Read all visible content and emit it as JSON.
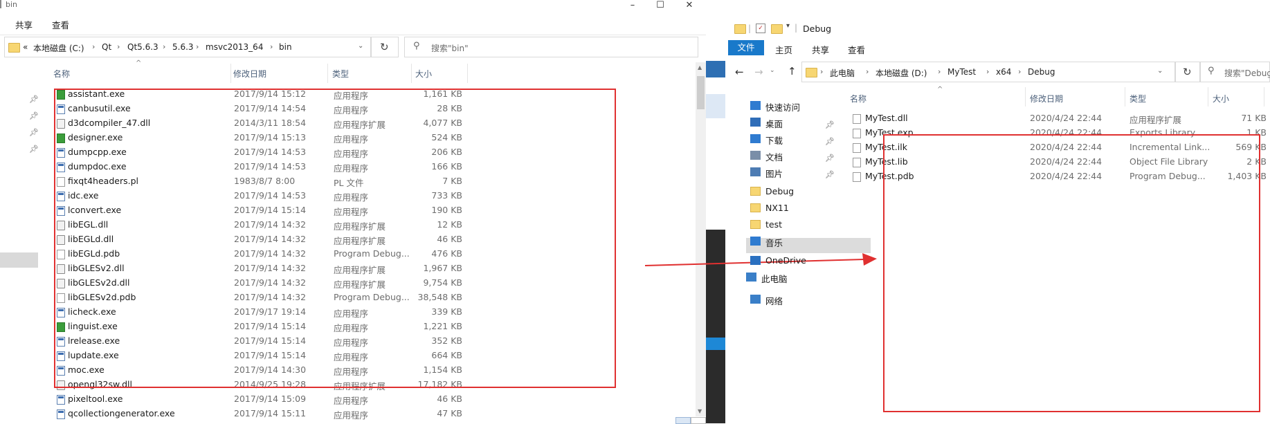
{
  "left_window": {
    "title": "bin",
    "ribbon_tabs": [
      "共享",
      "查看"
    ],
    "address": {
      "prefix": "«",
      "crumbs": [
        "本地磁盘 (C:)",
        "Qt",
        "Qt5.6.3",
        "5.6.3",
        "msvc2013_64",
        "bin"
      ]
    },
    "search_placeholder": "搜索\"bin\"",
    "columns": {
      "name": "名称",
      "date": "修改日期",
      "type": "类型",
      "size": "大小"
    },
    "files": [
      {
        "name": "assistant.exe",
        "date": "2017/9/14 15:12",
        "type": "应用程序",
        "size": "1,161 KB",
        "icon": "qt-icon"
      },
      {
        "name": "canbusutil.exe",
        "date": "2017/9/14 14:54",
        "type": "应用程序",
        "size": "28 KB",
        "icon": "exe-icon"
      },
      {
        "name": "d3dcompiler_47.dll",
        "date": "2014/3/11 18:54",
        "type": "应用程序扩展",
        "size": "4,077 KB",
        "icon": "dll-icon"
      },
      {
        "name": "designer.exe",
        "date": "2017/9/14 15:13",
        "type": "应用程序",
        "size": "524 KB",
        "icon": "qt-icon"
      },
      {
        "name": "dumpcpp.exe",
        "date": "2017/9/14 14:53",
        "type": "应用程序",
        "size": "206 KB",
        "icon": "exe-icon"
      },
      {
        "name": "dumpdoc.exe",
        "date": "2017/9/14 14:53",
        "type": "应用程序",
        "size": "166 KB",
        "icon": "exe-icon"
      },
      {
        "name": "fixqt4headers.pl",
        "date": "1983/8/7 8:00",
        "type": "PL 文件",
        "size": "7 KB",
        "icon": "doc-icon"
      },
      {
        "name": "idc.exe",
        "date": "2017/9/14 14:53",
        "type": "应用程序",
        "size": "733 KB",
        "icon": "exe-icon"
      },
      {
        "name": "lconvert.exe",
        "date": "2017/9/14 15:14",
        "type": "应用程序",
        "size": "190 KB",
        "icon": "exe-icon"
      },
      {
        "name": "libEGL.dll",
        "date": "2017/9/14 14:32",
        "type": "应用程序扩展",
        "size": "12 KB",
        "icon": "dll-icon"
      },
      {
        "name": "libEGLd.dll",
        "date": "2017/9/14 14:32",
        "type": "应用程序扩展",
        "size": "46 KB",
        "icon": "dll-icon"
      },
      {
        "name": "libEGLd.pdb",
        "date": "2017/9/14 14:32",
        "type": "Program Debug...",
        "size": "476 KB",
        "icon": "doc-icon"
      },
      {
        "name": "libGLESv2.dll",
        "date": "2017/9/14 14:32",
        "type": "应用程序扩展",
        "size": "1,967 KB",
        "icon": "dll-icon"
      },
      {
        "name": "libGLESv2d.dll",
        "date": "2017/9/14 14:32",
        "type": "应用程序扩展",
        "size": "9,754 KB",
        "icon": "dll-icon"
      },
      {
        "name": "libGLESv2d.pdb",
        "date": "2017/9/14 14:32",
        "type": "Program Debug...",
        "size": "38,548 KB",
        "icon": "doc-icon"
      },
      {
        "name": "licheck.exe",
        "date": "2017/9/17 19:14",
        "type": "应用程序",
        "size": "339 KB",
        "icon": "exe-icon"
      },
      {
        "name": "linguist.exe",
        "date": "2017/9/14 15:14",
        "type": "应用程序",
        "size": "1,221 KB",
        "icon": "qt-icon"
      },
      {
        "name": "lrelease.exe",
        "date": "2017/9/14 15:14",
        "type": "应用程序",
        "size": "352 KB",
        "icon": "exe-icon"
      },
      {
        "name": "lupdate.exe",
        "date": "2017/9/14 15:14",
        "type": "应用程序",
        "size": "664 KB",
        "icon": "exe-icon"
      },
      {
        "name": "moc.exe",
        "date": "2017/9/14 14:30",
        "type": "应用程序",
        "size": "1,154 KB",
        "icon": "exe-icon"
      },
      {
        "name": "opengl32sw.dll",
        "date": "2014/9/25 19:28",
        "type": "应用程序扩展",
        "size": "17,182 KB",
        "icon": "dll-icon"
      },
      {
        "name": "pixeltool.exe",
        "date": "2017/9/14 15:09",
        "type": "应用程序",
        "size": "46 KB",
        "icon": "exe-icon"
      },
      {
        "name": "qcollectiongenerator.exe",
        "date": "2017/9/14 15:11",
        "type": "应用程序",
        "size": "47 KB",
        "icon": "exe-icon"
      }
    ]
  },
  "right_window": {
    "title": "Debug",
    "ribbon_tabs": [
      "文件",
      "主页",
      "共享",
      "查看"
    ],
    "address": {
      "crumbs": [
        "此电脑",
        "本地磁盘 (D:)",
        "MyTest",
        "x64",
        "Debug"
      ]
    },
    "search_placeholder": "搜索\"Debug\"",
    "columns": {
      "name": "名称",
      "date": "修改日期",
      "type": "类型",
      "size": "大小"
    },
    "nav": [
      {
        "label": "快速访问",
        "icon": "star-icon"
      },
      {
        "label": "桌面",
        "icon": "desktop-icon"
      },
      {
        "label": "下载",
        "icon": "download-icon"
      },
      {
        "label": "文档",
        "icon": "documents-icon"
      },
      {
        "label": "图片",
        "icon": "pictures-icon"
      },
      {
        "label": "Debug",
        "icon": "folder-icon"
      },
      {
        "label": "NX11",
        "icon": "folder-icon"
      },
      {
        "label": "test",
        "icon": "folder-icon"
      },
      {
        "label": "音乐",
        "icon": "music-icon"
      },
      {
        "label": "OneDrive",
        "icon": "onedrive-icon"
      },
      {
        "label": "此电脑",
        "icon": "pc-icon"
      },
      {
        "label": "网络",
        "icon": "network-icon"
      }
    ],
    "files": [
      {
        "name": "MyTest.dll",
        "date": "2020/4/24 22:44",
        "type": "应用程序扩展",
        "size": "71 KB"
      },
      {
        "name": "MyTest.exp",
        "date": "2020/4/24 22:44",
        "type": "Exports Library ...",
        "size": "1 KB"
      },
      {
        "name": "MyTest.ilk",
        "date": "2020/4/24 22:44",
        "type": "Incremental Link...",
        "size": "569 KB"
      },
      {
        "name": "MyTest.lib",
        "date": "2020/4/24 22:44",
        "type": "Object File Library",
        "size": "2 KB"
      },
      {
        "name": "MyTest.pdb",
        "date": "2020/4/24 22:44",
        "type": "Program Debug...",
        "size": "1,403 KB"
      }
    ]
  },
  "colors": {
    "annotation_red": "#e03030",
    "ribbon_blue": "#1979ca",
    "folder_yellow": "#f7d672"
  }
}
